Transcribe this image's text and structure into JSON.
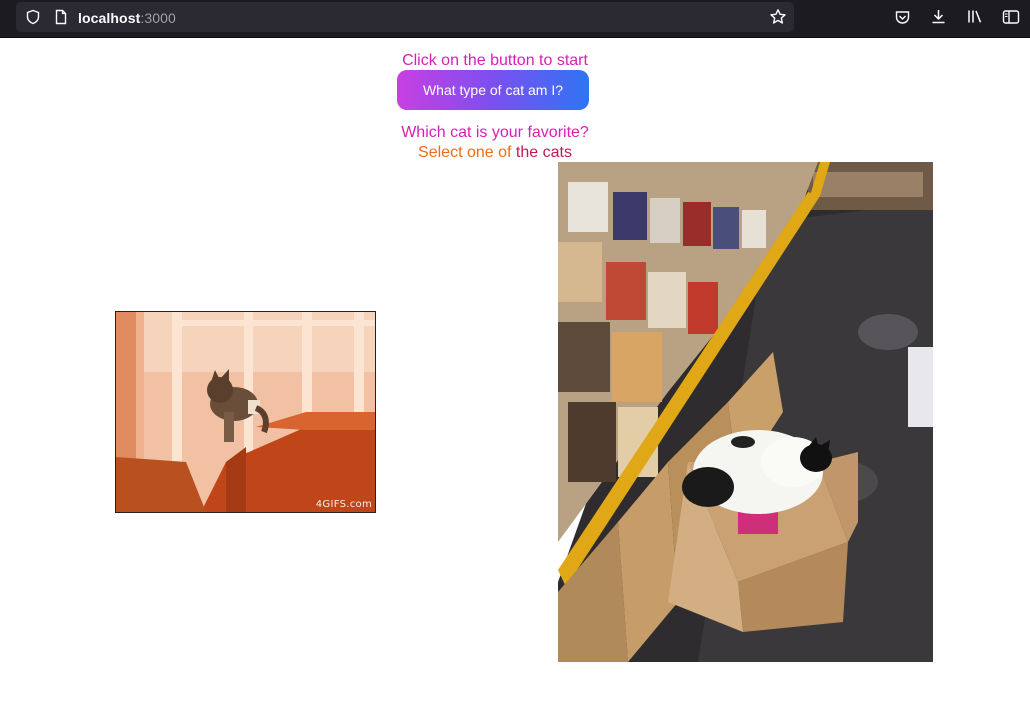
{
  "browser": {
    "url_host": "localhost",
    "url_port": ":3000",
    "icons": [
      "shield-icon",
      "page-icon",
      "bookmark-star-icon",
      "pocket-icon",
      "download-icon",
      "library-icon",
      "sidebar-icon"
    ]
  },
  "page": {
    "intro_text": "Click on the button to start",
    "quiz_button_label": "What type of cat am I?",
    "favorite_question": "Which cat is your favorite?",
    "select_prefix": "Select one of",
    "select_suffix": "the cats",
    "cats": [
      {
        "description": "cat climbing stairs gif",
        "watermark": "4GIFS.com"
      },
      {
        "description": "cat sleeping in a cardboard box in a record store"
      }
    ]
  },
  "colors": {
    "pink_text": "#d81fb4",
    "orange_text": "#ef6c1a",
    "magenta_text": "#c2185b",
    "button_gradient": [
      "#c93fe3",
      "#7c4ff0",
      "#2f74f5"
    ],
    "toolbar_bg": "#1c1b22"
  }
}
